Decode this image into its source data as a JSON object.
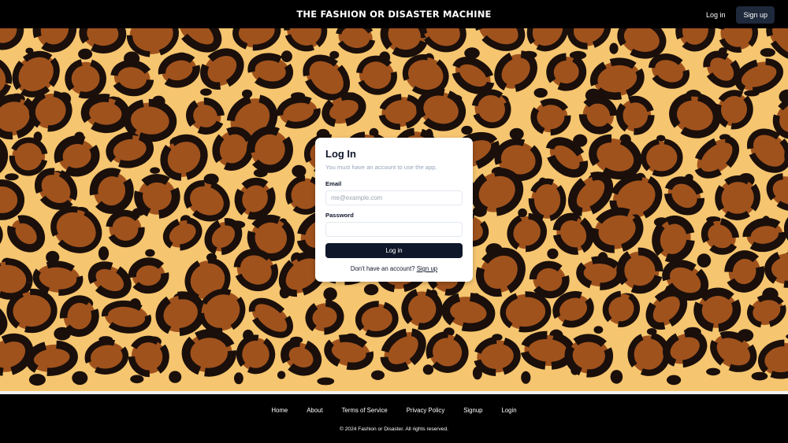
{
  "header": {
    "brand": "THE FASHION OR DISASTER MACHINE",
    "login_label": "Log in",
    "signup_label": "Sign up"
  },
  "hero": {
    "background": "leopard-print-pattern"
  },
  "login_card": {
    "title": "Log In",
    "subtitle": "You must have an account to use the app.",
    "email_label": "Email",
    "email_placeholder": "me@example.com",
    "email_value": "",
    "password_label": "Password",
    "password_value": "",
    "submit_label": "Log in",
    "signup_prompt": "Don't have an account?",
    "signup_link": "Sign up"
  },
  "footer": {
    "links": [
      "Home",
      "About",
      "Terms of Service",
      "Privacy Policy",
      "Signup",
      "Login"
    ],
    "copyright": "© 2024 Fashion or Disaster. All rights reserved."
  },
  "colors": {
    "header_bg": "#000000",
    "button_dark": "#0f172a",
    "leopard_base": "#f6c56f",
    "leopard_spot": "#1a0f0a",
    "leopard_center": "#a0521d"
  }
}
